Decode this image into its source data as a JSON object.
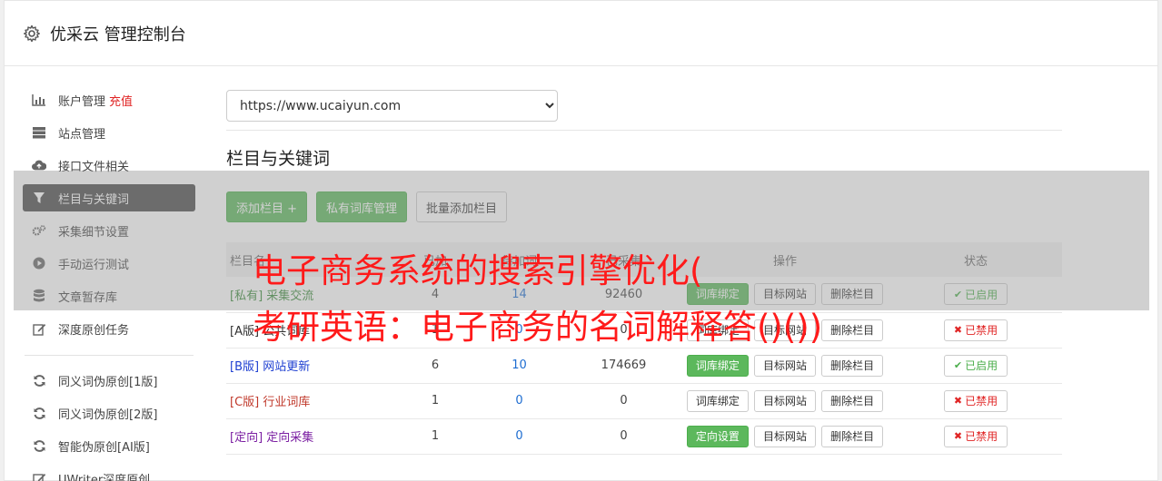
{
  "app": {
    "title": "优采云 管理控制台"
  },
  "sidebar": {
    "items": [
      {
        "label": "账户管理",
        "extra": "充值",
        "icon": "bar-chart-icon"
      },
      {
        "label": "站点管理",
        "icon": "server-icon"
      },
      {
        "label": "接口文件相关",
        "icon": "cloud-upload-icon"
      },
      {
        "label": "栏目与关键词",
        "icon": "filter-icon",
        "active": true
      },
      {
        "label": "采集细节设置",
        "icon": "cogs-icon"
      },
      {
        "label": "手动运行测试",
        "icon": "play-circle-icon"
      },
      {
        "label": "文章暂存库",
        "icon": "database-icon"
      },
      {
        "label": "深度原创任务",
        "icon": "edit-icon"
      },
      {
        "label": "同义词伪原创[1版]",
        "icon": "refresh-icon"
      },
      {
        "label": "同义词伪原创[2版]",
        "icon": "refresh-icon"
      },
      {
        "label": "智能伪原创[AI版]",
        "icon": "refresh-icon"
      },
      {
        "label": "UWriter深度原创",
        "icon": "edit-icon"
      }
    ]
  },
  "main": {
    "site_select": {
      "value": "https://www.ucaiyun.com"
    },
    "section_title": "栏目与关键词",
    "buttons": {
      "add_column": "添加栏目 +",
      "private_lib": "私有词库管理",
      "batch_add": "批量添加栏目"
    },
    "table": {
      "headers": [
        "栏目名",
        "已加",
        "待加词",
        "已采集",
        "操作",
        "状态"
      ],
      "rows": [
        {
          "name": "[私有] 采集交流",
          "name_color": "#3a8a3a",
          "a": "4",
          "b": "14",
          "c": "92460",
          "op1": "词库绑定",
          "op1_green": true,
          "op2": "目标网站",
          "op3": "删除栏目",
          "status": "已启用",
          "on": true
        },
        {
          "name": "[A版] 公共词库",
          "name_color": "#333333",
          "a": "1",
          "b": "0",
          "c": "0",
          "op1": "词库绑定",
          "op1_green": false,
          "op2": "目标网站",
          "op3": "删除栏目",
          "status": "已禁用",
          "on": false
        },
        {
          "name": "[B版] 网站更新",
          "name_color": "#1e3fd1",
          "a": "6",
          "b": "10",
          "c": "174669",
          "op1": "词库绑定",
          "op1_green": true,
          "op2": "目标网站",
          "op3": "删除栏目",
          "status": "已启用",
          "on": true
        },
        {
          "name": "[C版] 行业词库",
          "name_color": "#c0392b",
          "a": "1",
          "b": "0",
          "c": "0",
          "op1": "词库绑定",
          "op1_green": false,
          "op2": "目标网站",
          "op3": "删除栏目",
          "status": "已禁用",
          "on": false
        },
        {
          "name": "[定向] 定向采集",
          "name_color": "#7b1fa2",
          "a": "1",
          "b": "0",
          "c": "0",
          "op1": "定向设置",
          "op1_green": true,
          "op2": "目标网站",
          "op3": "删除栏目",
          "status": "已禁用",
          "on": false
        }
      ]
    }
  },
  "overlay": {
    "line1": "电子商务系统的搜索引擎优化(",
    "line2": "考研英语：电子商务的名词解释答()())"
  }
}
